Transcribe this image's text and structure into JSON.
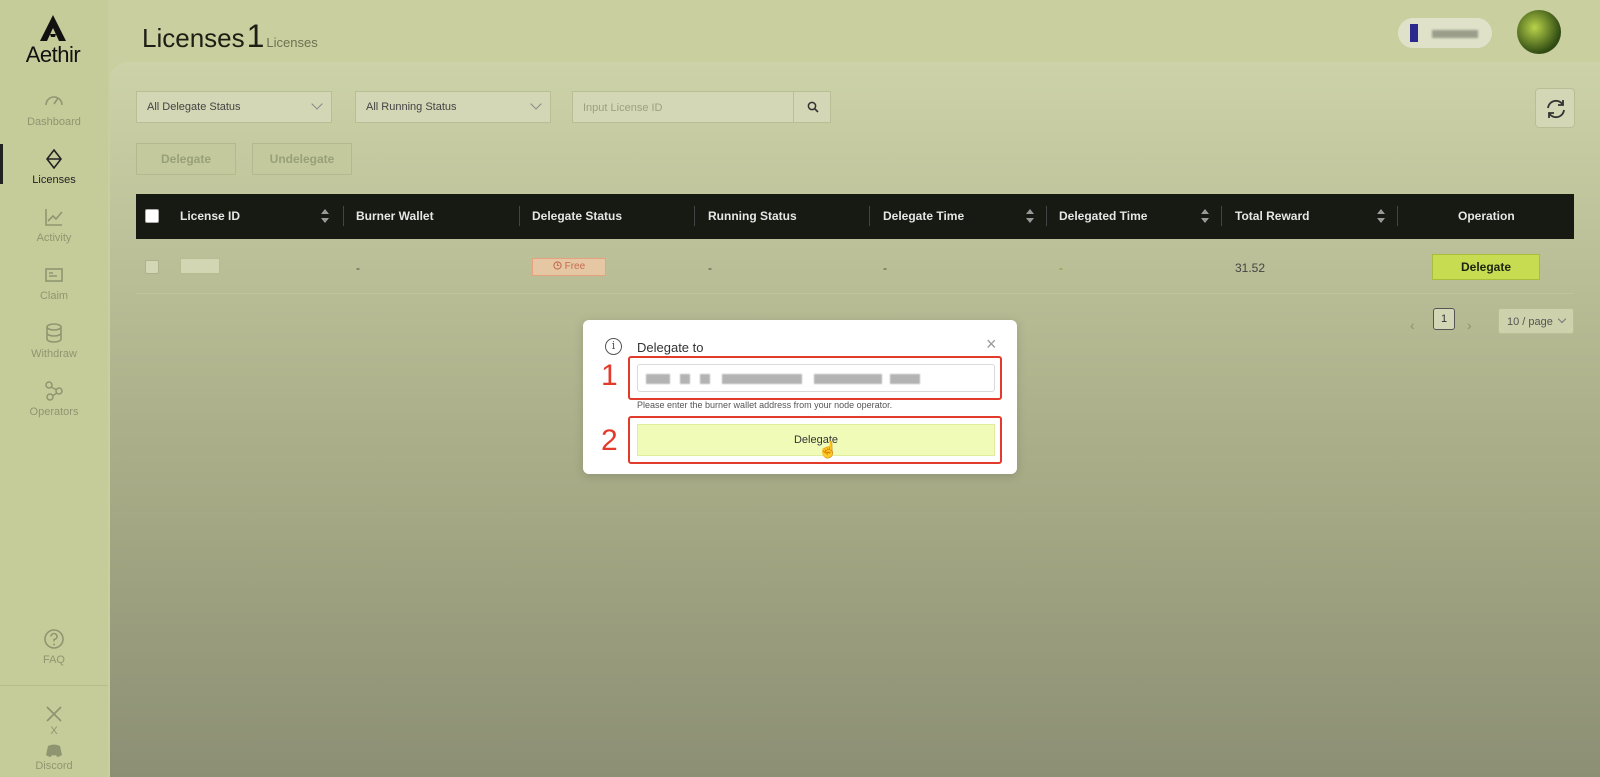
{
  "brand": {
    "name": "Aethir"
  },
  "sidebar": {
    "items": [
      {
        "label": "Dashboard",
        "icon": "gauge-icon",
        "active": false
      },
      {
        "label": "Licenses",
        "icon": "diamond-icon",
        "active": true
      },
      {
        "label": "Activity",
        "icon": "chart-line-icon",
        "active": false
      },
      {
        "label": "Claim",
        "icon": "card-icon",
        "active": false
      },
      {
        "label": "Withdraw",
        "icon": "database-icon",
        "active": false
      },
      {
        "label": "Operators",
        "icon": "nodes-icon",
        "active": false
      }
    ],
    "bottom": [
      {
        "label": "FAQ",
        "icon": "question-icon"
      },
      {
        "label": "X",
        "icon": "x-icon"
      },
      {
        "label": "Discord",
        "icon": "discord-icon"
      }
    ]
  },
  "header": {
    "title": "Licenses",
    "count": "1",
    "count_label": "Licenses"
  },
  "filters": {
    "delegate_status": "All Delegate Status",
    "running_status": "All Running Status",
    "license_placeholder": "Input License ID"
  },
  "actions": {
    "delegate": "Delegate",
    "undelegate": "Undelegate"
  },
  "table": {
    "columns": [
      "License ID",
      "Burner Wallet",
      "Delegate Status",
      "Running Status",
      "Delegate Time",
      "Delegated Time",
      "Total Reward",
      "Operation"
    ],
    "rows": [
      {
        "burner_wallet": "-",
        "delegate_status": "Free",
        "running_status": "-",
        "delegate_time": "-",
        "delegated_time": "-",
        "total_reward": "31.52",
        "operation": "Delegate"
      }
    ]
  },
  "pagination": {
    "current": "1",
    "page_size": "10 / page"
  },
  "modal": {
    "title": "Delegate to",
    "hint": "Please enter the burner wallet address from your node operator.",
    "button": "Delegate",
    "annotation_1": "1",
    "annotation_2": "2"
  },
  "colors": {
    "accent": "#c8dc52",
    "annotation": "#e23b2c",
    "header_bg": "#171a13"
  }
}
